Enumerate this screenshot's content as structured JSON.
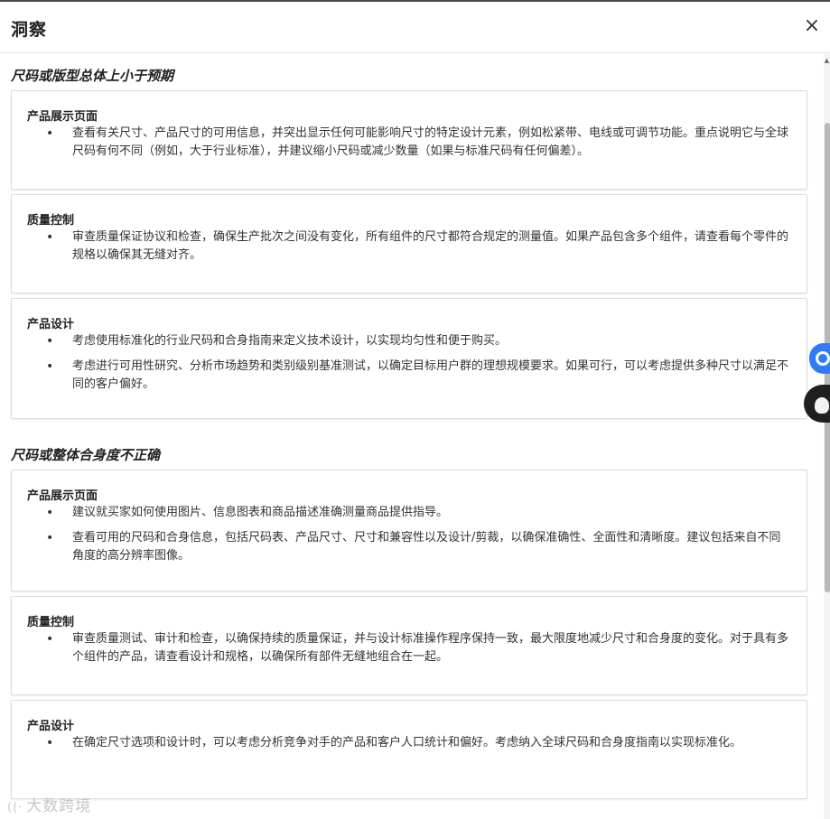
{
  "dialog": {
    "title": "洞察",
    "close_label": "×"
  },
  "sections": [
    {
      "title": "尺码或版型总体上小于预期",
      "cards": [
        {
          "title": "产品展示页面",
          "bullets": [
            "查看有关尺寸、产品尺寸的可用信息，并突出显示任何可能影响尺寸的特定设计元素，例如松紧带、电线或可调节功能。重点说明它与全球尺码有何不同（例如，大于行业标准），并建议缩小尺码或减少数量（如果与标准尺码有任何偏差）。"
          ]
        },
        {
          "title": "质量控制",
          "bullets": [
            "审查质量保证协议和检查，确保生产批次之间没有变化，所有组件的尺寸都符合规定的测量值。如果产品包含多个组件，请查看每个零件的规格以确保其无缝对齐。"
          ]
        },
        {
          "title": "产品设计",
          "bullets": [
            "考虑使用标准化的行业尺码和合身指南来定义技术设计，以实现均匀性和便于购买。",
            "考虑进行可用性研究、分析市场趋势和类别级别基准测试，以确定目标用户群的理想规模要求。如果可行，可以考虑提供多种尺寸以满足不同的客户偏好。"
          ]
        }
      ]
    },
    {
      "title": "尺码或整体合身度不正确",
      "cards": [
        {
          "title": "产品展示页面",
          "bullets": [
            "建议就买家如何使用图片、信息图表和商品描述准确测量商品提供指导。",
            "查看可用的尺码和合身信息，包括尺码表、产品尺寸、尺寸和兼容性以及设计/剪裁，以确保准确性、全面性和清晰度。建议包括来自不同角度的高分辨率图像。"
          ]
        },
        {
          "title": "质量控制",
          "bullets": [
            "审查质量测试、审计和检查，以确保持续的质量保证，并与设计标准操作程序保持一致，最大限度地减少尺寸和合身度的变化。对于具有多个组件的产品，请查看设计和规格，以确保所有部件无缝地组合在一起。"
          ]
        },
        {
          "title": "产品设计",
          "bullets": [
            "在确定尺寸选项和设计时，可以考虑分析竞争对手的产品和客户人口统计和偏好。考虑纳入全球尺码和合身度指南以实现标准化。"
          ]
        }
      ]
    }
  ],
  "watermark": {
    "icon": "sound-wave-icon",
    "text": "大数跨境"
  },
  "side_widgets": [
    {
      "icon": "chat-bubble-icon",
      "color": "#2f7cf6"
    },
    {
      "icon": "avatar-icon",
      "color": "#1f1f1f"
    }
  ]
}
